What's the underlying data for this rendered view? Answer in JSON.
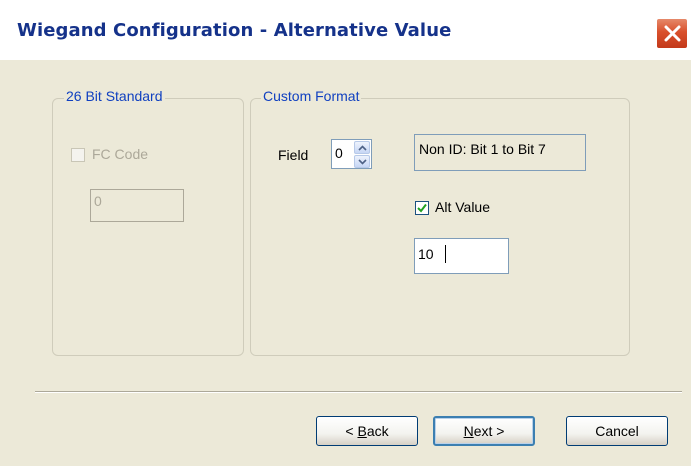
{
  "window": {
    "title": "Wiegand Configuration - Alternative Value"
  },
  "standard_group": {
    "legend": "26 Bit Standard",
    "fc_code_label": "FC Code",
    "fc_code_checked": false,
    "fc_code_value": "0"
  },
  "custom_group": {
    "legend": "Custom Format",
    "field_label": "Field",
    "field_value": "0",
    "bit_range_text": "Non ID: Bit 1 to Bit 7",
    "alt_value_label": "Alt Value",
    "alt_value_checked": true,
    "alt_value": "10"
  },
  "buttons": {
    "back_prefix": "< ",
    "back_mnemonic": "B",
    "back_rest": "ack",
    "next_mnemonic": "N",
    "next_rest": "ext >",
    "cancel": "Cancel"
  },
  "colors": {
    "dialog_background": "#ECE9D8",
    "title_text": "#15328a",
    "group_legend": "#1040c0",
    "disabled_text": "#aca899",
    "close_button": "#d9502c"
  }
}
